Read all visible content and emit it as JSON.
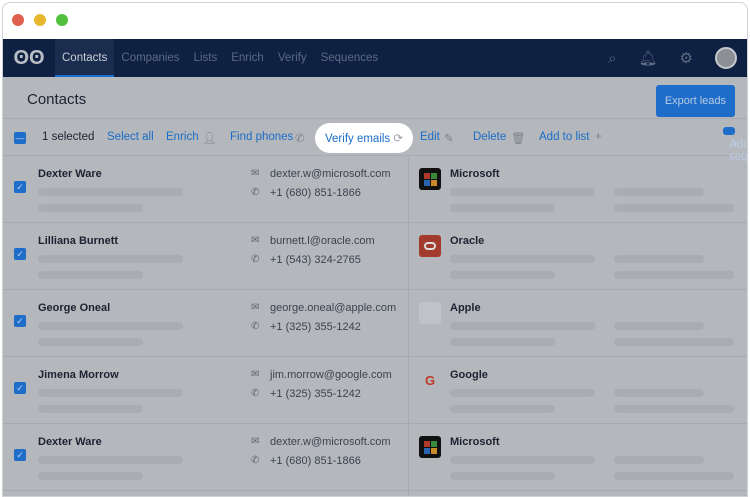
{
  "nav": {
    "tabs": [
      "Contacts",
      "Companies",
      "Lists",
      "Enrich",
      "Verify",
      "Sequences"
    ]
  },
  "header": {
    "title": "Contacts",
    "export_label": "Export leads"
  },
  "toolbar": {
    "selected": "1 selected",
    "select_all": "Select all",
    "enrich": "Enrich",
    "find_phones": "Find phones",
    "verify_emails": "Verify emails",
    "edit": "Edit",
    "delete": "Delete",
    "add_to_list": "Add to list",
    "add_to_sequence": "Add to sequence"
  },
  "rows": [
    {
      "name": "Dexter Ware",
      "email": "dexter.w@microsoft.com",
      "phone": "+1 (680) 851-1866",
      "company": "Microsoft"
    },
    {
      "name": "Lilliana Burnett",
      "email": "burnett.l@oracle.com",
      "phone": "+1 (543) 324-2765",
      "company": "Oracle"
    },
    {
      "name": "George Oneal",
      "email": "george.oneal@apple.com",
      "phone": "+1 (325) 355-1242",
      "company": "Apple"
    },
    {
      "name": "Jimena Morrow",
      "email": "jim.morrow@google.com",
      "phone": "+1 (325) 355-1242",
      "company": "Google"
    },
    {
      "name": "Dexter Ware",
      "email": "dexter.w@microsoft.com",
      "phone": "+1 (680) 851-1866",
      "company": "Microsoft"
    }
  ]
}
